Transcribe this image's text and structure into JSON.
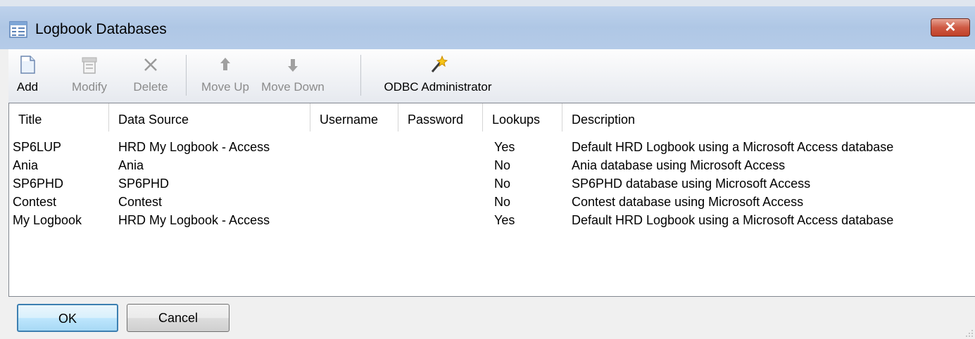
{
  "window": {
    "title": "Logbook Databases",
    "close_label": "✕"
  },
  "toolbar": {
    "add": "Add",
    "modify": "Modify",
    "delete": "Delete",
    "move_up": "Move Up",
    "move_down": "Move Down",
    "odbc": "ODBC Administrator"
  },
  "columns": [
    "Title",
    "Data Source",
    "Username",
    "Password",
    "Lookups",
    "Description"
  ],
  "rows": [
    {
      "title": "SP6LUP",
      "source": "HRD My Logbook - Access",
      "username": "",
      "password": "",
      "lookups": "Yes",
      "description": "Default HRD Logbook using a Microsoft Access database"
    },
    {
      "title": "Ania",
      "source": "Ania",
      "username": "",
      "password": "",
      "lookups": "No",
      "description": "Ania database using Microsoft Access"
    },
    {
      "title": "SP6PHD",
      "source": "SP6PHD",
      "username": "",
      "password": "",
      "lookups": "No",
      "description": "SP6PHD database using Microsoft Access"
    },
    {
      "title": "Contest",
      "source": "Contest",
      "username": "",
      "password": "",
      "lookups": "No",
      "description": "Contest database using Microsoft Access"
    },
    {
      "title": "My Logbook",
      "source": "HRD My Logbook - Access",
      "username": "",
      "password": "",
      "lookups": "Yes",
      "description": "Default HRD Logbook using a Microsoft Access database"
    }
  ],
  "buttons": {
    "ok": "OK",
    "cancel": "Cancel"
  },
  "icons": {
    "title": "table-window-icon",
    "add": "new-document-icon",
    "modify": "edit-document-icon",
    "delete": "delete-x-icon",
    "move_up": "arrow-up-icon",
    "move_down": "arrow-down-icon",
    "odbc": "magic-wand-icon"
  },
  "colors": {
    "titlebar": "#b5cbe8",
    "close": "#c04128",
    "default_button_border": "#3c7fb1"
  }
}
